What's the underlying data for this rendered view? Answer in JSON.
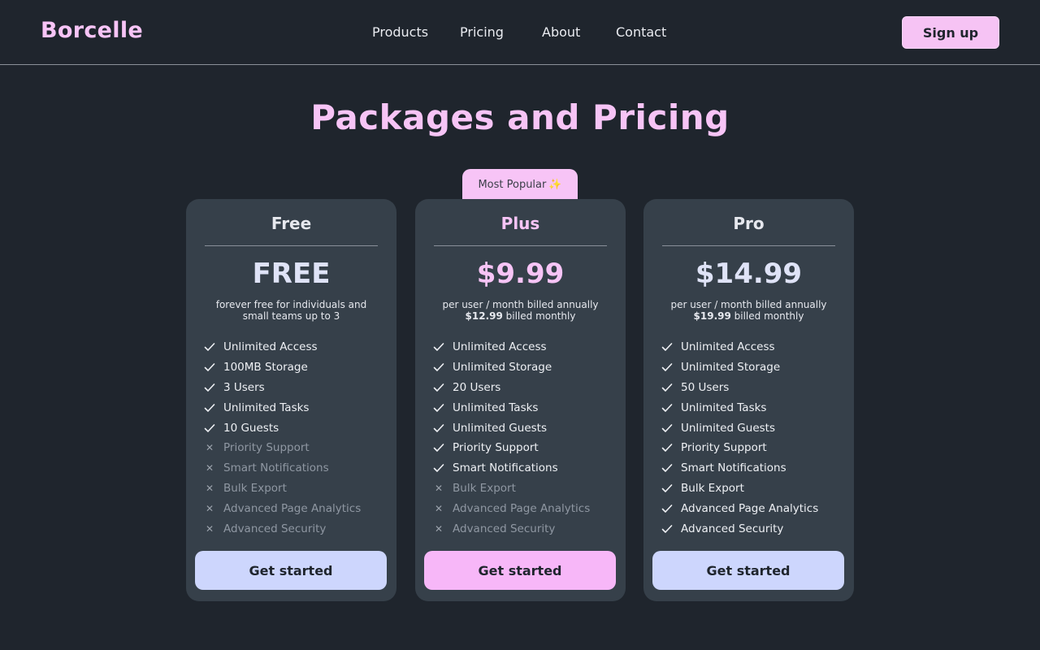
{
  "brand": {
    "logo": "Borcelle"
  },
  "nav": {
    "items": [
      "Products",
      "Pricing",
      "About",
      "Contact"
    ],
    "signup_label": "Sign up"
  },
  "page": {
    "title": "Packages and Pricing"
  },
  "badge": {
    "label": "Most Popular"
  },
  "colors": {
    "background": "#1f252d",
    "card": "#36404a",
    "accent_pink": "#f7c4f6",
    "accent_blue": "#cdd6fd"
  },
  "plans": [
    {
      "name": "Free",
      "price": "FREE",
      "note_line1": "forever free for individuals and",
      "note_line2": "small teams up to 3",
      "cta": "Get started",
      "features": [
        {
          "label": "Unlimited Access",
          "included": true
        },
        {
          "label": "100MB Storage",
          "included": true
        },
        {
          "label": "3 Users",
          "included": true
        },
        {
          "label": "Unlimited Tasks",
          "included": true
        },
        {
          "label": "10 Guests",
          "included": true
        },
        {
          "label": "Priority Support",
          "included": false
        },
        {
          "label": "Smart Notifications",
          "included": false
        },
        {
          "label": "Bulk Export",
          "included": false
        },
        {
          "label": "Advanced Page Analytics",
          "included": false
        },
        {
          "label": "Advanced Security",
          "included": false
        }
      ]
    },
    {
      "name": "Plus",
      "price": "$9.99",
      "note_line1": "per user / month billed annually",
      "note_monthly_price": "$12.99",
      "note_monthly_suffix": " billed monthly",
      "cta": "Get started",
      "features": [
        {
          "label": "Unlimited Access",
          "included": true
        },
        {
          "label": "Unlimited Storage",
          "included": true
        },
        {
          "label": "20 Users",
          "included": true
        },
        {
          "label": "Unlimited Tasks",
          "included": true
        },
        {
          "label": "Unlimited Guests",
          "included": true
        },
        {
          "label": "Priority Support",
          "included": true
        },
        {
          "label": "Smart Notifications",
          "included": true
        },
        {
          "label": "Bulk Export",
          "included": false
        },
        {
          "label": "Advanced Page Analytics",
          "included": false
        },
        {
          "label": "Advanced Security",
          "included": false
        }
      ]
    },
    {
      "name": "Pro",
      "price": "$14.99",
      "note_line1": "per user / month billed annually",
      "note_monthly_price": "$19.99",
      "note_monthly_suffix": " billed monthly",
      "cta": "Get started",
      "features": [
        {
          "label": "Unlimited Access",
          "included": true
        },
        {
          "label": "Unlimited Storage",
          "included": true
        },
        {
          "label": "50 Users",
          "included": true
        },
        {
          "label": "Unlimited Tasks",
          "included": true
        },
        {
          "label": "Unlimited Guests",
          "included": true
        },
        {
          "label": "Priority Support",
          "included": true
        },
        {
          "label": "Smart Notifications",
          "included": true
        },
        {
          "label": "Bulk Export",
          "included": true
        },
        {
          "label": "Advanced Page Analytics",
          "included": true
        },
        {
          "label": "Advanced Security",
          "included": true
        }
      ]
    }
  ]
}
